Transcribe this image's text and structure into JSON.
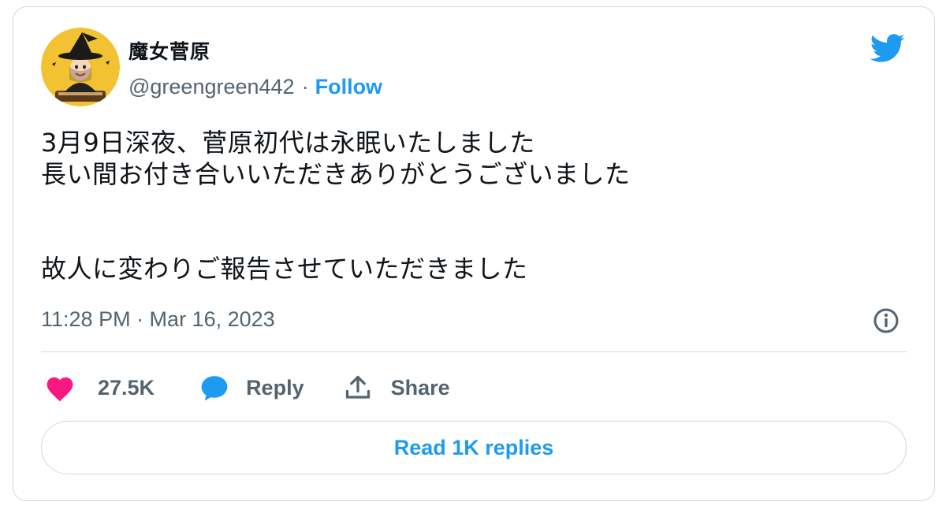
{
  "author": {
    "display_name": "魔女菅原",
    "handle": "@greengreen442",
    "separator": "·",
    "follow_label": "Follow"
  },
  "tweet": {
    "lines": [
      "3月9日深夜、菅原初代は永眠いたしました",
      "長い間お付き合いいただきありがとうございました",
      "故人に変わりご報告させていただきました"
    ],
    "timestamp": "11:28 PM · Mar 16, 2023"
  },
  "actions": {
    "like_count": "27.5K",
    "reply_label": "Reply",
    "share_label": "Share"
  },
  "read_replies_label": "Read 1K replies",
  "icons": {
    "brand": "twitter-bird-icon",
    "info": "info-icon",
    "like": "heart-icon",
    "reply": "speech-bubble-icon",
    "share": "share-upload-icon"
  },
  "colors": {
    "accent": "#1d9bf0",
    "like": "#f91880",
    "text_primary": "#0f1419",
    "text_secondary": "#536471",
    "border": "#cfd9de"
  }
}
